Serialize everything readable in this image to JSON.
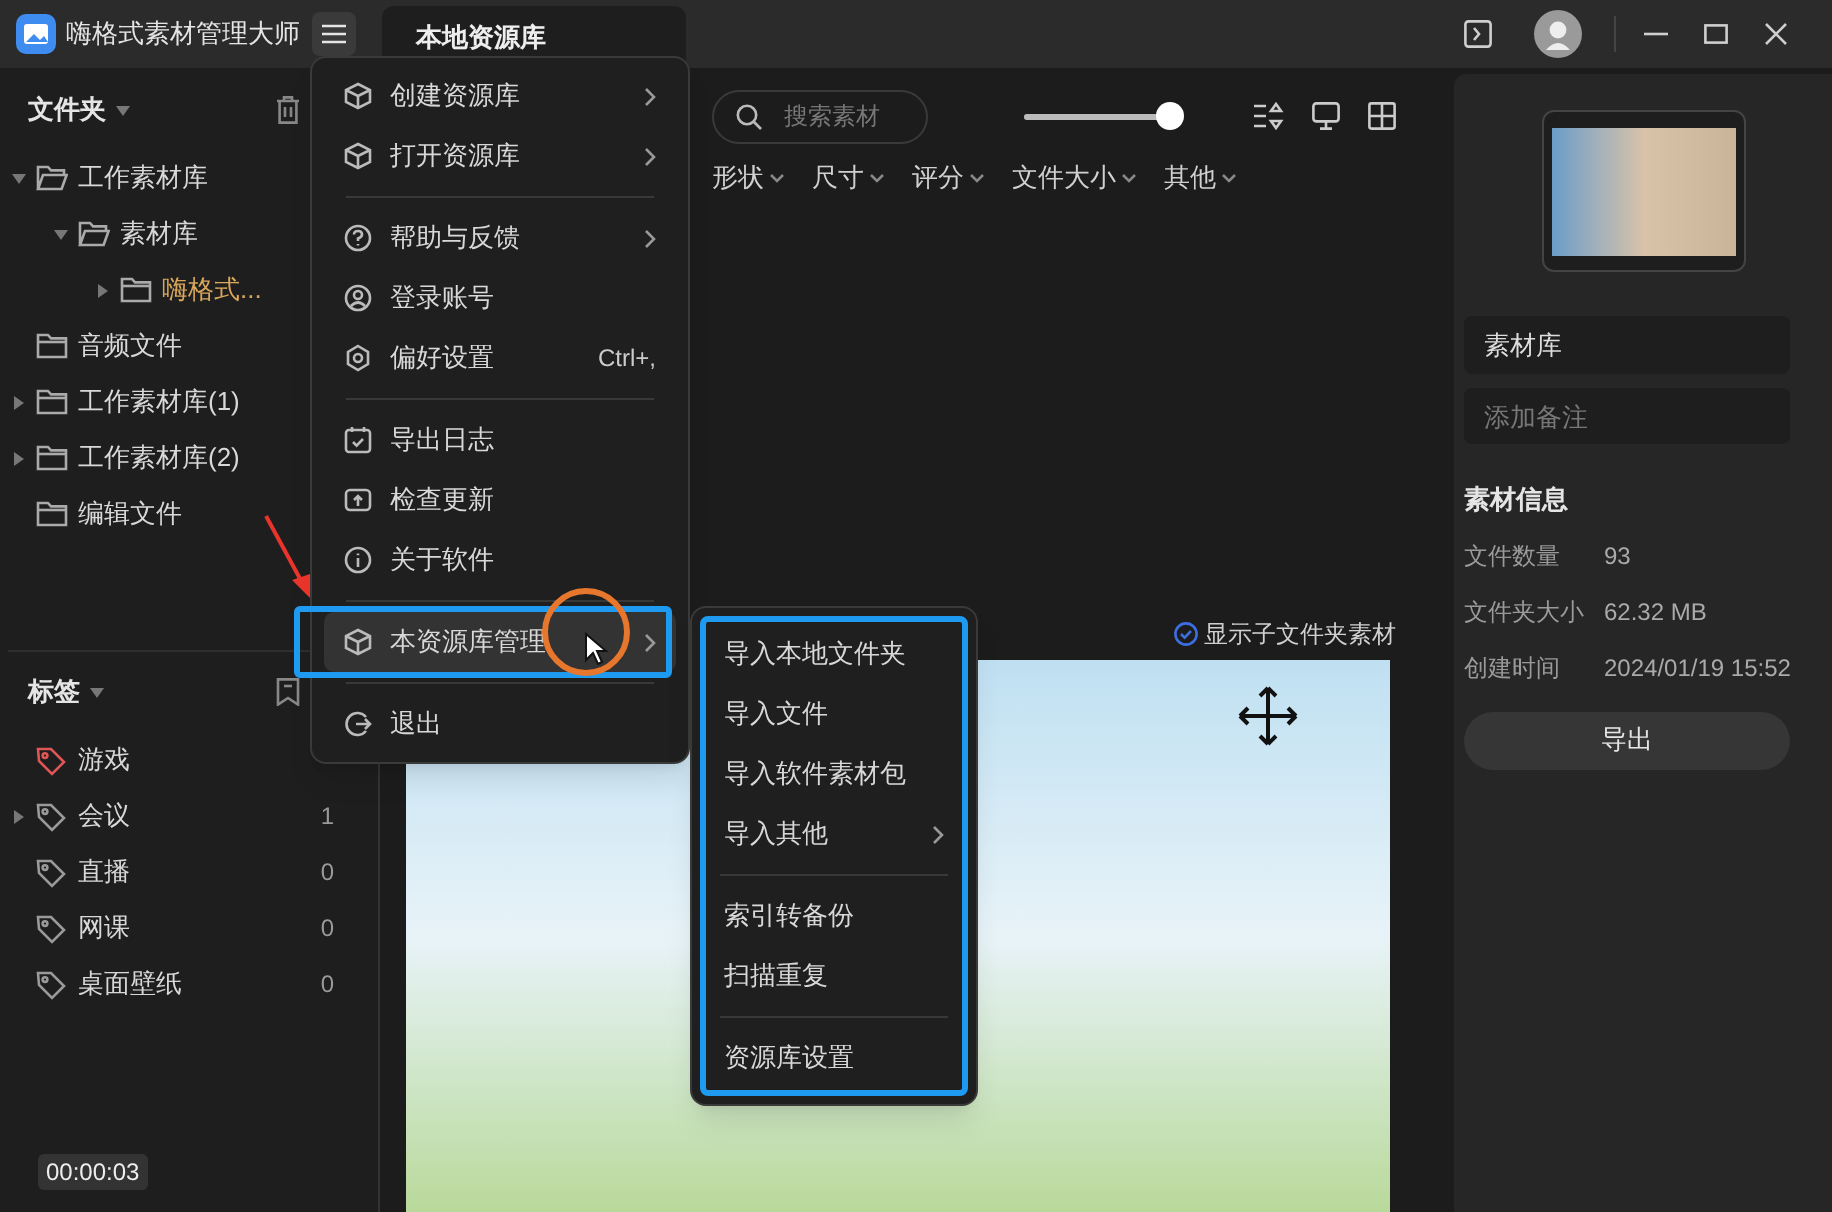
{
  "app": {
    "title": "嗨格式素材管理大师"
  },
  "tab": {
    "label": "本地资源库",
    "selected": true
  },
  "folders": {
    "title": "文件夹",
    "items": [
      {
        "label": "工作素材库",
        "expanded": true,
        "selected": false,
        "children": [
          {
            "label": "素材库",
            "expanded": true,
            "selected": false,
            "children": [
              {
                "label": "嗨格式...",
                "expanded": false,
                "selected": true
              }
            ]
          }
        ]
      },
      {
        "label": "音频文件",
        "selected": false
      },
      {
        "label": "工作素材库(1)",
        "expanded": false,
        "selected": false
      },
      {
        "label": "工作素材库(2)",
        "expanded": false,
        "selected": false
      },
      {
        "label": "编辑文件",
        "selected": false
      }
    ]
  },
  "tags": {
    "title": "标签",
    "items": [
      {
        "label": "游戏",
        "color": "#e05555"
      },
      {
        "label": "会议",
        "count": "1",
        "expanded": false,
        "color": "#9a9a9a"
      },
      {
        "label": "直播",
        "count": "0",
        "color": "#9a9a9a"
      },
      {
        "label": "网课",
        "count": "0",
        "color": "#9a9a9a"
      },
      {
        "label": "桌面壁纸",
        "count": "0",
        "color": "#9a9a9a"
      }
    ]
  },
  "menu": {
    "items": [
      {
        "kind": "item",
        "label": "创建资源库",
        "submenu": true,
        "selected": false
      },
      {
        "kind": "item",
        "label": "打开资源库",
        "submenu": true,
        "selected": false
      },
      {
        "kind": "separator"
      },
      {
        "kind": "item",
        "label": "帮助与反馈",
        "submenu": true,
        "selected": false
      },
      {
        "kind": "item",
        "label": "登录账号",
        "selected": false
      },
      {
        "kind": "item",
        "label": "偏好设置",
        "shortcut": "Ctrl+,",
        "selected": false
      },
      {
        "kind": "separator"
      },
      {
        "kind": "item",
        "label": "导出日志",
        "selected": false
      },
      {
        "kind": "item",
        "label": "检查更新",
        "selected": false
      },
      {
        "kind": "item",
        "label": "关于软件",
        "selected": false
      },
      {
        "kind": "separator"
      },
      {
        "kind": "item",
        "label": "本资源库管理",
        "submenu": true,
        "selected": true
      },
      {
        "kind": "separator"
      },
      {
        "kind": "item",
        "label": "退出",
        "selected": false
      }
    ]
  },
  "submenu": {
    "items": [
      {
        "kind": "item",
        "label": "导入本地文件夹"
      },
      {
        "kind": "item",
        "label": "导入文件"
      },
      {
        "kind": "item",
        "label": "导入软件素材包"
      },
      {
        "kind": "item",
        "label": "导入其他",
        "submenu": true
      },
      {
        "kind": "separator"
      },
      {
        "kind": "item",
        "label": "索引转备份"
      },
      {
        "kind": "item",
        "label": "扫描重复"
      },
      {
        "kind": "separator"
      },
      {
        "kind": "item",
        "label": "资源库设置"
      }
    ]
  },
  "toolbar": {
    "search": {
      "placeholder": "搜索素材"
    },
    "zoom": {
      "level": 1
    }
  },
  "filters": [
    "形状",
    "尺寸",
    "评分",
    "文件大小",
    "其他"
  ],
  "show_subfolders": {
    "label": "显示子文件夹素材",
    "checked": true
  },
  "details": {
    "name": "素材库",
    "note": {
      "placeholder": "添加备注"
    },
    "section": "素材信息",
    "rows": [
      {
        "label": "文件数量",
        "value": "93"
      },
      {
        "label": "文件夹大小",
        "value": "62.32 MB"
      },
      {
        "label": "创建时间",
        "value": "2024/01/19 15:52"
      }
    ],
    "button": "导出"
  },
  "recording_time": "00:00:03"
}
